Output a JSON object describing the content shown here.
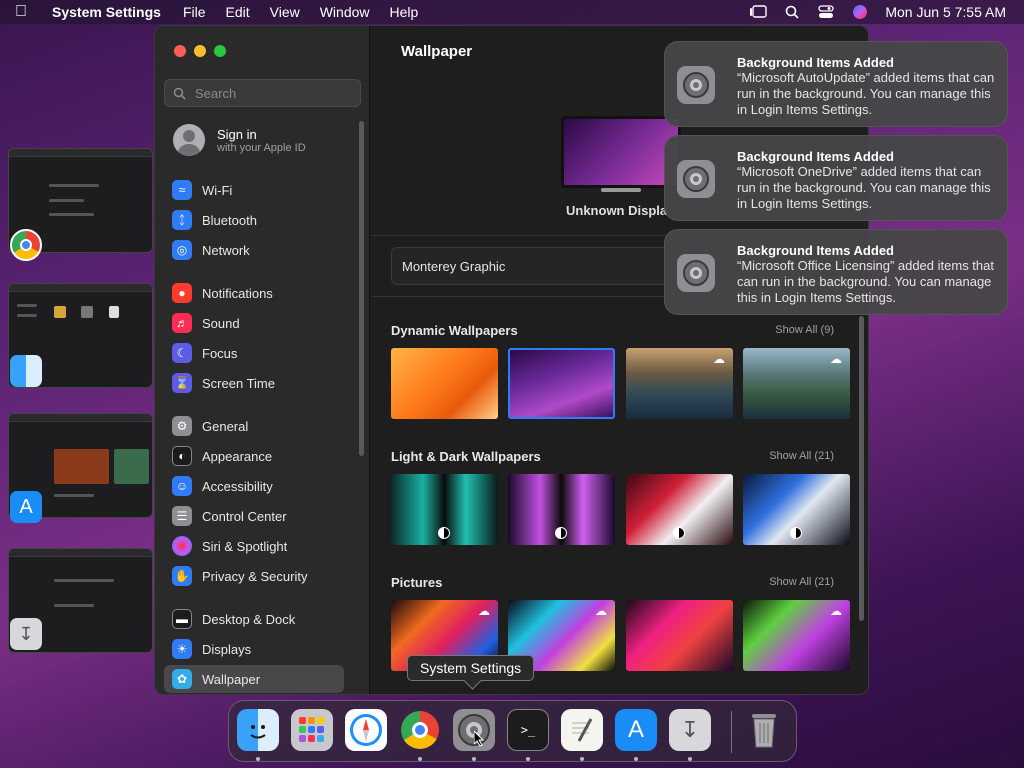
{
  "menubar": {
    "app_name": "System Settings",
    "menus": [
      "File",
      "Edit",
      "View",
      "Window",
      "Help"
    ],
    "clock": "Mon Jun 5  7:55 AM"
  },
  "sidebar": {
    "search_placeholder": "Search",
    "signin_title": "Sign in",
    "signin_subtitle": "with your Apple ID",
    "items": [
      {
        "label": "Wi-Fi",
        "color": "#2f7cf6"
      },
      {
        "label": "Bluetooth",
        "color": "#2f7cf6"
      },
      {
        "label": "Network",
        "color": "#2f7cf6"
      },
      {
        "label": "Notifications",
        "color": "#ff3b30"
      },
      {
        "label": "Sound",
        "color": "#ff2d55"
      },
      {
        "label": "Focus",
        "color": "#5e5ce6"
      },
      {
        "label": "Screen Time",
        "color": "#5e5ce6"
      },
      {
        "label": "General",
        "color": "#8e8e93"
      },
      {
        "label": "Appearance",
        "color": "#1c1c1e"
      },
      {
        "label": "Accessibility",
        "color": "#2f7cf6"
      },
      {
        "label": "Control Center",
        "color": "#8e8e93"
      },
      {
        "label": "Siri & Spotlight",
        "color": "#bf5af2"
      },
      {
        "label": "Privacy & Security",
        "color": "#2f7cf6"
      },
      {
        "label": "Desktop & Dock",
        "color": "#1c1c1e"
      },
      {
        "label": "Displays",
        "color": "#2f7cf6"
      },
      {
        "label": "Wallpaper",
        "color": "#32ade6"
      }
    ]
  },
  "content": {
    "title": "Wallpaper",
    "display_label": "Unknown Displa",
    "selected_wallpaper": "Monterey Graphic",
    "sections": [
      {
        "title": "Dynamic Wallpapers",
        "show_all": "Show All (9)"
      },
      {
        "title": "Light & Dark Wallpapers",
        "show_all": "Show All (21)"
      },
      {
        "title": "Pictures",
        "show_all": "Show All (21)"
      }
    ]
  },
  "notifications": [
    {
      "title": "Background Items Added",
      "body": "“Microsoft AutoUpdate” added items that can run in the background. You can manage this in Login Items Settings."
    },
    {
      "title": "Background Items Added",
      "body": "“Microsoft OneDrive” added items that can run in the background. You can manage this in Login Items Settings."
    },
    {
      "title": "Background Items Added",
      "body": "“Microsoft Office Licensing” added items that can run in the background. You can manage this in Login Items Settings."
    }
  ],
  "tooltip": "System Settings",
  "dock": [
    "Finder",
    "Launchpad",
    "Safari",
    "Google Chrome",
    "System Settings",
    "Terminal",
    "TextEdit",
    "App Store",
    "Installer",
    "Trash"
  ]
}
